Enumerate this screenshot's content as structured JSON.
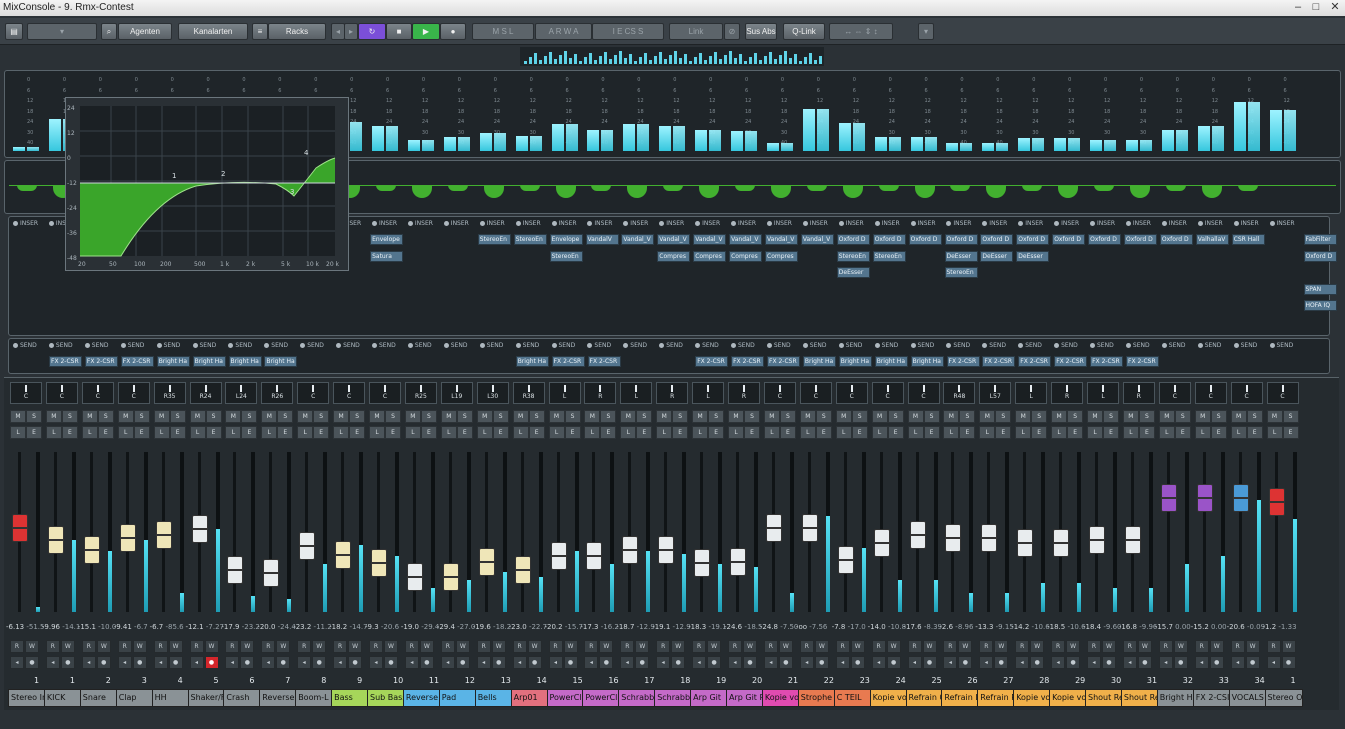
{
  "window": {
    "title": "MixConsole - 9. Rmx-Contest"
  },
  "toolbar": {
    "agents": "Agenten",
    "channel_types": "Kanalarten",
    "racks": "Racks",
    "msra": [
      "M",
      "S",
      "L",
      "A",
      "R",
      "W",
      "A"
    ],
    "iecs": [
      "I",
      "E",
      "CS",
      "S"
    ],
    "link": "Link",
    "sus_abs": "Sus Abs",
    "qlink": "Q-Link"
  },
  "eq_editor": {
    "freq_labels": [
      "20",
      "50",
      "100",
      "200",
      "500",
      "1 k",
      "2 k",
      "5 k",
      "10 k",
      "20 k"
    ],
    "db_labels": [
      "24",
      "12",
      "0",
      "-12",
      "-24",
      "-36",
      "-48"
    ],
    "nodes": [
      "1",
      "2",
      "3",
      "4"
    ]
  },
  "meter_scale": [
    "0",
    "6",
    "12",
    "18",
    "24",
    "30",
    "40"
  ],
  "inserts": {
    "header": "INSER",
    "slots": [
      {
        "col": 1,
        "row": 0,
        "text": "Stere"
      },
      {
        "col": 1,
        "row": 1,
        "text": "Enve"
      },
      {
        "col": 9,
        "row": 0,
        "text": "Envelope"
      },
      {
        "col": 9,
        "row": 1,
        "text": "Satura"
      },
      {
        "col": 12,
        "row": 0,
        "text": "StereoEn"
      },
      {
        "col": 13,
        "row": 0,
        "text": "StereoEn"
      },
      {
        "col": 14,
        "row": 0,
        "text": "Envelope"
      },
      {
        "col": 14,
        "row": 1,
        "text": "StereoEn"
      },
      {
        "col": 15,
        "row": 0,
        "text": "VandalV"
      },
      {
        "col": 16,
        "row": 0,
        "text": "Vandal_V"
      },
      {
        "col": 17,
        "row": 0,
        "text": "Vandal_V"
      },
      {
        "col": 17,
        "row": 1,
        "text": "Compres"
      },
      {
        "col": 18,
        "row": 0,
        "text": "Vandal_V"
      },
      {
        "col": 18,
        "row": 1,
        "text": "Compres"
      },
      {
        "col": 19,
        "row": 0,
        "text": "Vandal_V"
      },
      {
        "col": 19,
        "row": 1,
        "text": "Compres"
      },
      {
        "col": 20,
        "row": 0,
        "text": "Vandal_V"
      },
      {
        "col": 20,
        "row": 1,
        "text": "Compres"
      },
      {
        "col": 21,
        "row": 0,
        "text": "Vandal_V"
      },
      {
        "col": 22,
        "row": 0,
        "text": "Oxford D"
      },
      {
        "col": 22,
        "row": 1,
        "text": "StereoEn"
      },
      {
        "col": 22,
        "row": 2,
        "text": "DeEsser"
      },
      {
        "col": 23,
        "row": 0,
        "text": "Oxford D"
      },
      {
        "col": 23,
        "row": 1,
        "text": "StereoEn"
      },
      {
        "col": 24,
        "row": 0,
        "text": "Oxford D"
      },
      {
        "col": 25,
        "row": 0,
        "text": "Oxford D"
      },
      {
        "col": 25,
        "row": 1,
        "text": "DeEsser"
      },
      {
        "col": 25,
        "row": 2,
        "text": "StereoEn"
      },
      {
        "col": 26,
        "row": 0,
        "text": "Oxford D"
      },
      {
        "col": 26,
        "row": 1,
        "text": "DeEsser"
      },
      {
        "col": 27,
        "row": 0,
        "text": "Oxford D"
      },
      {
        "col": 27,
        "row": 1,
        "text": "DeEsser"
      },
      {
        "col": 28,
        "row": 0,
        "text": "Oxford D"
      },
      {
        "col": 29,
        "row": 0,
        "text": "Oxford D"
      },
      {
        "col": 30,
        "row": 0,
        "text": "Oxford D"
      },
      {
        "col": 31,
        "row": 0,
        "text": "Oxford D"
      },
      {
        "col": 32,
        "row": 0,
        "text": "ValhallaV"
      },
      {
        "col": 33,
        "row": 0,
        "text": "CSR Hall"
      },
      {
        "col": 35,
        "row": 0,
        "text": "FabFilter"
      },
      {
        "col": 35,
        "row": 1,
        "text": "Oxford D"
      },
      {
        "col": 35,
        "row": 3,
        "text": "SPAN"
      },
      {
        "col": 35,
        "row": 4,
        "text": "HOFA IQ"
      }
    ]
  },
  "sends": {
    "header": "SEND",
    "slots": [
      {
        "col": 1,
        "text": "FX 2-CSR"
      },
      {
        "col": 2,
        "text": "FX 2-CSR"
      },
      {
        "col": 3,
        "text": "FX 2-CSR"
      },
      {
        "col": 4,
        "text": "Bright Ha"
      },
      {
        "col": 5,
        "text": "Bright Ha"
      },
      {
        "col": 6,
        "text": "Bright Ha"
      },
      {
        "col": 7,
        "text": "Bright Ha"
      },
      {
        "col": 14,
        "text": "Bright Ha"
      },
      {
        "col": 15,
        "text": "FX 2-CSR"
      },
      {
        "col": 16,
        "text": "FX 2-CSR"
      },
      {
        "col": 19,
        "text": "FX 2-CSR"
      },
      {
        "col": 20,
        "text": "FX 2-CSR"
      },
      {
        "col": 21,
        "text": "FX 2-CSR"
      },
      {
        "col": 22,
        "text": "Bright Ha"
      },
      {
        "col": 23,
        "text": "Bright Ha"
      },
      {
        "col": 24,
        "text": "Bright Ha"
      },
      {
        "col": 25,
        "text": "Bright Ha"
      },
      {
        "col": 26,
        "text": "FX 2-CSR"
      },
      {
        "col": 27,
        "text": "FX 2-CSR"
      },
      {
        "col": 28,
        "text": "FX 2-CSR"
      },
      {
        "col": 29,
        "text": "FX 2-CSR"
      },
      {
        "col": 30,
        "text": "FX 2-CSR"
      },
      {
        "col": 31,
        "text": "FX 2-CSR"
      }
    ]
  },
  "channels": [
    {
      "num": "1",
      "name": "Stereo In",
      "pan": "C",
      "vol": "-6.13",
      "peak": "-51.5",
      "color": "#8a9296",
      "cap": "#d33",
      "fader": 0.55,
      "meter": 0.03
    },
    {
      "num": "1",
      "name": "KICK",
      "pan": "C",
      "vol": "-9.96",
      "peak": "-14.1",
      "color": "#8a9296",
      "cap": "#efe6b8",
      "fader": 0.47,
      "meter": 0.45
    },
    {
      "num": "2",
      "name": "Snare",
      "pan": "C",
      "vol": "-15.1",
      "peak": "-10.0",
      "color": "#8a9296",
      "cap": "#efe6b8",
      "fader": 0.4,
      "meter": 0.38
    },
    {
      "num": "3",
      "name": "Clap",
      "pan": "C",
      "vol": "-9.41",
      "peak": "-6.7",
      "color": "#8a9296",
      "cap": "#efe6b8",
      "fader": 0.48,
      "meter": 0.45
    },
    {
      "num": "4",
      "name": "HH",
      "pan": "R35",
      "vol": "-6.7",
      "peak": "-85.6",
      "color": "#8a9296",
      "cap": "#efe6b8",
      "fader": 0.5,
      "meter": 0.12
    },
    {
      "num": "5",
      "name": "Shaker/F",
      "pan": "R24",
      "vol": "-12.1",
      "peak": "-7.27",
      "color": "#8a9296",
      "cap": "#e8ecee",
      "fader": 0.54,
      "meter": 0.52
    },
    {
      "num": "6",
      "name": "Crash",
      "pan": "L24",
      "vol": "-17.9",
      "peak": "-23.2",
      "color": "#8a9296",
      "cap": "#e8ecee",
      "fader": 0.27,
      "meter": 0.1
    },
    {
      "num": "7",
      "name": "Reverse",
      "pan": "R26",
      "vol": "-20.0",
      "peak": "-24.4",
      "color": "#8a9296",
      "cap": "#e8ecee",
      "fader": 0.25,
      "meter": 0.08
    },
    {
      "num": "8",
      "name": "Boom-L",
      "pan": "C",
      "vol": "-23.2",
      "peak": "-11.2",
      "color": "#8a9296",
      "cap": "#e8ecee",
      "fader": 0.43,
      "meter": 0.3
    },
    {
      "num": "9",
      "name": "Bass",
      "pan": "C",
      "vol": "-18.2",
      "peak": "-14.7",
      "color": "#a6d65a",
      "cap": "#efe6b8",
      "fader": 0.37,
      "meter": 0.42
    },
    {
      "num": "10",
      "name": "Sub Bass",
      "pan": "C",
      "vol": "-9.3",
      "peak": "-20.6",
      "color": "#a6d65a",
      "cap": "#efe6b8",
      "fader": 0.31,
      "meter": 0.35
    },
    {
      "num": "11",
      "name": "Reverse",
      "pan": "R25",
      "vol": "-19.0",
      "peak": "-29.4",
      "color": "#5ab4e6",
      "cap": "#e8ecee",
      "fader": 0.22,
      "meter": 0.15
    },
    {
      "num": "12",
      "name": "Pad",
      "pan": "L19",
      "vol": "-29.4",
      "peak": "-27.0",
      "color": "#5ab4e6",
      "cap": "#efe6b8",
      "fader": 0.22,
      "meter": 0.2
    },
    {
      "num": "13",
      "name": "Bells",
      "pan": "L30",
      "vol": "-19.6",
      "peak": "-18.2",
      "color": "#5ab4e6",
      "cap": "#efe6b8",
      "fader": 0.32,
      "meter": 0.25
    },
    {
      "num": "14",
      "name": "Arp01",
      "pan": "R38",
      "vol": "-23.0",
      "peak": "-22.7",
      "color": "#e2707e",
      "cap": "#efe6b8",
      "fader": 0.27,
      "meter": 0.22
    },
    {
      "num": "15",
      "name": "PowerCl",
      "pan": "L",
      "vol": "-20.2",
      "peak": "-15.7",
      "color": "#c46ac8",
      "cap": "#e8ecee",
      "fader": 0.36,
      "meter": 0.38
    },
    {
      "num": "16",
      "name": "PowerCl",
      "pan": "R",
      "vol": "-17.3",
      "peak": "-16.2",
      "color": "#c46ac8",
      "cap": "#e8ecee",
      "fader": 0.36,
      "meter": 0.3
    },
    {
      "num": "17",
      "name": "Schrabb",
      "pan": "L",
      "vol": "-18.7",
      "peak": "-12.9",
      "color": "#c46ac8",
      "cap": "#e8ecee",
      "fader": 0.4,
      "meter": 0.38
    },
    {
      "num": "18",
      "name": "Schrabb",
      "pan": "R",
      "vol": "-19.1",
      "peak": "-12.9",
      "color": "#c46ac8",
      "cap": "#e8ecee",
      "fader": 0.4,
      "meter": 0.36
    },
    {
      "num": "19",
      "name": "Arp Git",
      "pan": "L",
      "vol": "-18.3",
      "peak": "-19.1",
      "color": "#c46ac8",
      "cap": "#e8ecee",
      "fader": 0.31,
      "meter": 0.3
    },
    {
      "num": "20",
      "name": "Arp Git R",
      "pan": "R",
      "vol": "-24.6",
      "peak": "-18.5",
      "color": "#c46ac8",
      "cap": "#e8ecee",
      "fader": 0.32,
      "meter": 0.28
    },
    {
      "num": "21",
      "name": "Kopie vo",
      "pan": "C",
      "vol": "-24.8",
      "peak": "-7.50",
      "color": "#e04bb0",
      "cap": "#e8ecee",
      "fader": 0.55,
      "meter": 0.12
    },
    {
      "num": "22",
      "name": "Strophe",
      "pan": "C",
      "vol": "-oo",
      "peak": "-7.56",
      "color": "#e87a50",
      "cap": "#e8ecee",
      "fader": 0.55,
      "meter": 0.6
    },
    {
      "num": "23",
      "name": "C TEIL",
      "pan": "C",
      "vol": "-7.8",
      "peak": "-17.0",
      "color": "#e87a50",
      "cap": "#e8ecee",
      "fader": 0.33,
      "meter": 0.4
    },
    {
      "num": "24",
      "name": "Kopie vo",
      "pan": "C",
      "vol": "-14.0",
      "peak": "-10.8",
      "color": "#f0b04a",
      "cap": "#e8ecee",
      "fader": 0.45,
      "meter": 0.2
    },
    {
      "num": "25",
      "name": "Refrain 0",
      "pan": "C",
      "vol": "-17.6",
      "peak": "-8.39",
      "color": "#f0b04a",
      "cap": "#e8ecee",
      "fader": 0.5,
      "meter": 0.2
    },
    {
      "num": "26",
      "name": "Refrain L",
      "pan": "R48",
      "vol": "-2.6",
      "peak": "-8.96",
      "color": "#f0b04a",
      "cap": "#e8ecee",
      "fader": 0.48,
      "meter": 0.12
    },
    {
      "num": "27",
      "name": "Refrain R",
      "pan": "L57",
      "vol": "-13.3",
      "peak": "-9.15",
      "color": "#f0b04a",
      "cap": "#e8ecee",
      "fader": 0.48,
      "meter": 0.12
    },
    {
      "num": "28",
      "name": "Kopie vo",
      "pan": "L",
      "vol": "-14.2",
      "peak": "-10.6",
      "color": "#f0b04a",
      "cap": "#e8ecee",
      "fader": 0.45,
      "meter": 0.18
    },
    {
      "num": "29",
      "name": "Kopie vo",
      "pan": "R",
      "vol": "-18.5",
      "peak": "-10.6",
      "color": "#f0b04a",
      "cap": "#e8ecee",
      "fader": 0.45,
      "meter": 0.18
    },
    {
      "num": "30",
      "name": "Shout Re",
      "pan": "L",
      "vol": "-18.4",
      "peak": "-9.60",
      "color": "#f0b04a",
      "cap": "#e8ecee",
      "fader": 0.47,
      "meter": 0.15
    },
    {
      "num": "31",
      "name": "Shout Re",
      "pan": "R",
      "vol": "-16.8",
      "peak": "-9.96",
      "color": "#f0b04a",
      "cap": "#e8ecee",
      "fader": 0.47,
      "meter": 0.15
    },
    {
      "num": "32",
      "name": "Bright H",
      "pan": "C",
      "vol": "-15.7",
      "peak": "0.00",
      "color": "#8a9296",
      "cap": "#9a54c8",
      "fader": 0.75,
      "meter": 0.3
    },
    {
      "num": "33",
      "name": "FX 2-CSI",
      "pan": "C",
      "vol": "-15.2",
      "peak": "0.00",
      "color": "#8a9296",
      "cap": "#9a54c8",
      "fader": 0.75,
      "meter": 0.35
    },
    {
      "num": "34",
      "name": "VOCALS",
      "pan": "C",
      "vol": "-20.6",
      "peak": "-0.09",
      "color": "#8a9296",
      "cap": "#4a9ad6",
      "fader": 0.75,
      "meter": 0.7
    },
    {
      "num": "1",
      "name": "Stereo O",
      "pan": "C",
      "vol": "-1.2",
      "peak": "-1.33",
      "color": "#8a9296",
      "cap": "#d33",
      "fader": 0.72,
      "meter": 0.58
    }
  ]
}
